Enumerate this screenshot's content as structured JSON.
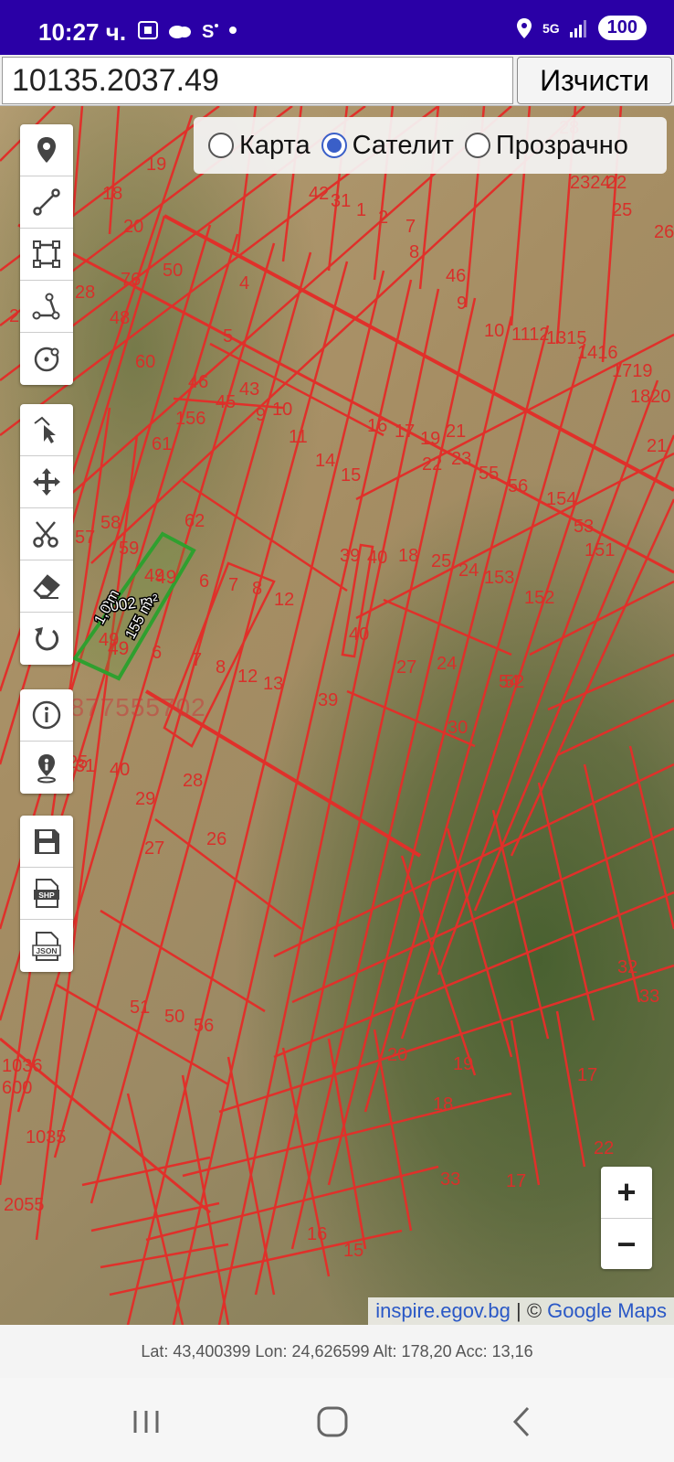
{
  "status_bar": {
    "time": "10:27 ч.",
    "network": "5G",
    "battery": "100"
  },
  "search": {
    "value": "10135.2037.49",
    "clear_label": "Изчисти"
  },
  "layers": {
    "options": [
      {
        "label": "Карта",
        "selected": false
      },
      {
        "label": "Сателит",
        "selected": true
      },
      {
        "label": "Прозрачно",
        "selected": false
      }
    ]
  },
  "toolbar_top": [
    "map-pin-icon",
    "line-icon",
    "rectangle-icon",
    "angle-icon",
    "circle-target-icon"
  ],
  "toolbar_edit": [
    "select-cursor-icon",
    "move-icon",
    "cut-icon",
    "eraser-icon",
    "undo-icon"
  ],
  "toolbar_info": [
    "info-icon",
    "person-info-icon"
  ],
  "toolbar_export": [
    "save-icon",
    "shp-file-icon",
    "json-file-icon"
  ],
  "export_labels": {
    "shp": "SHP",
    "json": "JSON"
  },
  "selected_parcel": {
    "area": "6002 m²",
    "side_a": "1,0 m",
    "side_b": "155 m",
    "number": "49"
  },
  "watermark_phone": "0877555702",
  "parcel_labels": [
    "19",
    "18",
    "20",
    "50",
    "48",
    "76",
    "28",
    "60",
    "4",
    "5",
    "46",
    "45",
    "43",
    "9",
    "10",
    "156",
    "61",
    "11",
    "14",
    "15",
    "16",
    "17",
    "19",
    "21",
    "22",
    "23",
    "55",
    "56",
    "154",
    "58",
    "59",
    "62",
    "57",
    "49",
    "6",
    "7",
    "8",
    "12",
    "39",
    "40",
    "18",
    "25",
    "24",
    "153",
    "152",
    "151",
    "53",
    "49",
    "6",
    "7",
    "8",
    "12",
    "13",
    "39",
    "40",
    "27",
    "31",
    "40",
    "29",
    "28",
    "27",
    "26",
    "30",
    "25",
    "24",
    "23",
    "42",
    "31",
    "1",
    "2",
    "7",
    "8",
    "46",
    "9",
    "10",
    "1112",
    "1315",
    "1416",
    "1719",
    "1820",
    "21",
    "22",
    "2324",
    "25",
    "26",
    "28",
    "52",
    "54",
    "51",
    "50",
    "56",
    "33",
    "32",
    "20",
    "19",
    "18",
    "17",
    "22",
    "2055",
    "600",
    "1035",
    "1036",
    "16",
    "15",
    "33",
    "17",
    "32",
    "256",
    "156",
    "49",
    "20"
  ],
  "zoom": {
    "in": "+",
    "out": "−"
  },
  "attribution": {
    "source": "inspire.egov.bg",
    "separator": " | © ",
    "provider": "Google Maps"
  },
  "coordinates": "Lat: 43,400399 Lon: 24,626599 Alt: 178,20 Acc: 13,16",
  "nav": [
    "recent-apps-icon",
    "home-icon",
    "back-icon"
  ]
}
